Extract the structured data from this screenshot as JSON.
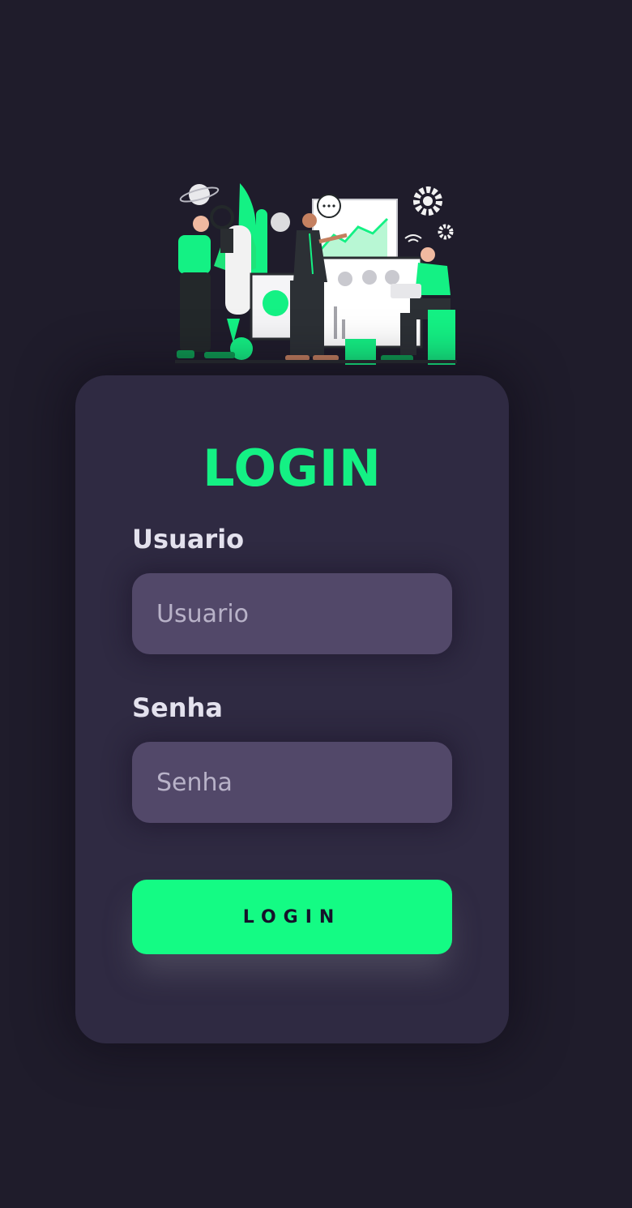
{
  "app": {
    "illustration_icon": "team-analytics-illustration",
    "accent_color": "#14f184"
  },
  "login_card": {
    "title": "LOGIN",
    "username": {
      "label": "Usuario",
      "placeholder": "Usuario",
      "value": ""
    },
    "password": {
      "label": "Senha",
      "placeholder": "Senha",
      "value": ""
    },
    "submit_label": "LOGIN"
  }
}
